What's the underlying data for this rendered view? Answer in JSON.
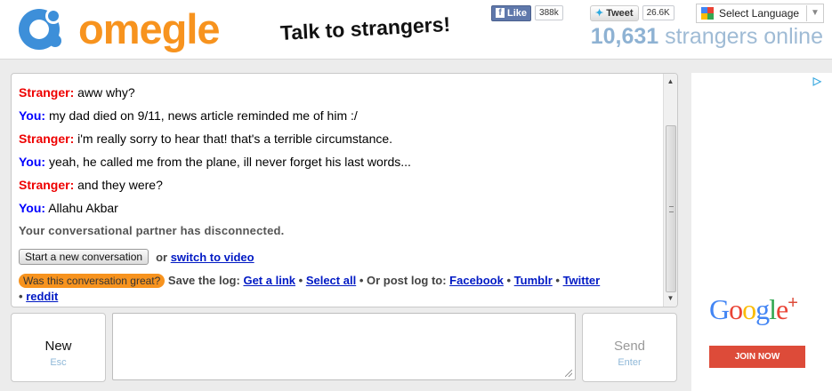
{
  "header": {
    "logo_text": "omegle",
    "tagline": "Talk to strangers!",
    "fb_like_label": "Like",
    "fb_like_count": "388k",
    "tweet_label": "Tweet",
    "tweet_count": "26.6K",
    "language_label": "Select Language",
    "online_count": "10,631",
    "online_suffix": "strangers online"
  },
  "chat": {
    "messages": [
      {
        "who": "Stranger:",
        "text": "aww why?"
      },
      {
        "who": "You:",
        "text": "my dad died on 9/11, news article reminded me of him :/"
      },
      {
        "who": "Stranger:",
        "text": "i'm really sorry to hear that! that's a terrible circumstance."
      },
      {
        "who": "You:",
        "text": "yeah, he called me from the plane, ill never forget his last words..."
      },
      {
        "who": "Stranger:",
        "text": "and they were?"
      },
      {
        "who": "You:",
        "text": "Allahu Akbar"
      }
    ],
    "status": "Your conversational partner has disconnected.",
    "start_new_label": "Start a new conversation",
    "or_text": "or",
    "switch_video_label": "switch to video",
    "great_label": "Was this conversation great?",
    "save_log_text": "Save the log:",
    "get_link_label": "Get a link",
    "bullet": "•",
    "select_all_label": "Select all",
    "post_log_text": "Or post log to:",
    "facebook_label": "Facebook",
    "tumblr_label": "Tumblr",
    "twitter_label": "Twitter",
    "reddit_label": "reddit"
  },
  "controls": {
    "new_label": "New",
    "new_key": "Esc",
    "send_label": "Send",
    "send_key": "Enter",
    "message_value": ""
  },
  "ad": {
    "google_text": "Google",
    "plus": "+",
    "join_label": "JOIN NOW"
  },
  "colors": {
    "brand_orange": "#f7931e",
    "logo_blue": "#3d8fd9",
    "stranger_red": "#e00000",
    "you_blue": "#0000ff",
    "link_blue": "#0019c4"
  }
}
